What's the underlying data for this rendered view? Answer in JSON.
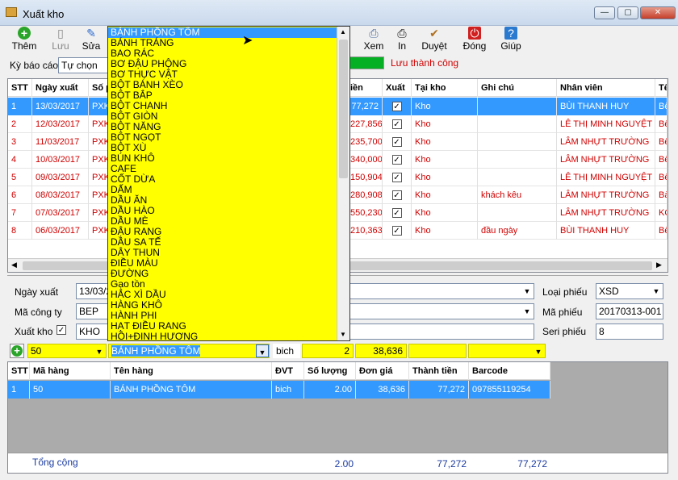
{
  "window": {
    "title": "Xuất kho",
    "min": "—",
    "max": "▢",
    "close": "✕"
  },
  "toolbar": [
    {
      "label": "Thêm",
      "icon": "add-icon",
      "glyph": "+"
    },
    {
      "label": "Lưu",
      "icon": "save-icon",
      "glyph": "▯"
    },
    {
      "label": "Sửa",
      "icon": "edit-icon",
      "glyph": "✎"
    },
    {
      "label": "Xem",
      "icon": "preview-icon",
      "glyph": "⎙"
    },
    {
      "label": "In",
      "icon": "print-icon",
      "glyph": "⎙"
    },
    {
      "label": "Duyệt",
      "icon": "approve-icon",
      "glyph": "✔"
    },
    {
      "label": "Đóng",
      "icon": "power-icon",
      "glyph": "⏻"
    },
    {
      "label": "Giúp",
      "icon": "help-book-icon",
      "glyph": "?"
    }
  ],
  "filter": {
    "label": "Kỳ báo cáo",
    "value": "Tự chọn"
  },
  "status": {
    "text": "Lưu thành công",
    "color": "#d00000",
    "bar_color": "#06b025",
    "progress": 1.0
  },
  "main_grid": {
    "headers": [
      "STT",
      "Ngày xuất",
      "Số p",
      "iền",
      "Xuất",
      "Tại kho",
      "Ghi chú",
      "Nhân viên",
      "Tê"
    ],
    "rows": [
      {
        "stt": "1",
        "date": "13/03/2017",
        "so": "PXK",
        "tien": "77,272",
        "kho": "Kho",
        "note": "",
        "nv": "BÙI THANH HUY",
        "te": "Bế"
      },
      {
        "stt": "2",
        "date": "12/03/2017",
        "so": "PXK",
        "tien": "227,856",
        "kho": "Kho",
        "note": "",
        "nv": "LÊ THỊ MINH NGUYỆT",
        "te": "Bế"
      },
      {
        "stt": "3",
        "date": "11/03/2017",
        "so": "PXK",
        "tien": "235,700",
        "kho": "Kho",
        "note": "",
        "nv": "LÂM NHỰT TRƯỜNG",
        "te": "Bế"
      },
      {
        "stt": "4",
        "date": "10/03/2017",
        "so": "PXK",
        "tien": "340,000",
        "kho": "Kho",
        "note": "",
        "nv": "LÂM NHỰT TRƯỜNG",
        "te": "Bế"
      },
      {
        "stt": "5",
        "date": "09/03/2017",
        "so": "PXK",
        "tien": "150,904",
        "kho": "Kho",
        "note": "",
        "nv": "LÊ THỊ MINH NGUYỆT",
        "te": "Bế"
      },
      {
        "stt": "6",
        "date": "08/03/2017",
        "so": "PXK",
        "tien": "280,908",
        "kho": "Kho",
        "note": "khách kêu",
        "nv": "LÂM NHỰT TRƯỜNG",
        "te": "Bà"
      },
      {
        "stt": "7",
        "date": "07/03/2017",
        "so": "PXK",
        "tien": "550,230",
        "kho": "Kho",
        "note": "",
        "nv": "LÂM NHỰT TRƯỜNG",
        "te": "KQ"
      },
      {
        "stt": "8",
        "date": "06/03/2017",
        "so": "PXK",
        "tien": "210,363",
        "kho": "Kho",
        "note": "đầu ngày",
        "nv": "BÙI THANH HUY",
        "te": "Bế"
      }
    ]
  },
  "form": {
    "ngay_xuat_label": "Ngày xuất",
    "ngay_xuat": "13/03/2",
    "ma_cty_label": "Mã công ty",
    "ma_cty": "BEP",
    "xuat_kho_label": "Xuất kho",
    "xuat_kho": "KHO",
    "loai_phieu_label": "Loại phiếu",
    "loai_phieu": "XSD",
    "ma_phieu_label": "Mã phiếu",
    "ma_phieu": "20170313-001",
    "seri_label": "Seri phiếu",
    "seri": "8"
  },
  "entry": {
    "ma": "50",
    "ten": "BÁNH PHỒNG TÔM",
    "dvt": "bich",
    "sl": "2",
    "gia": "38,636"
  },
  "detail_grid": {
    "headers": [
      "STT",
      "Mã hàng",
      "Tên hàng",
      "ĐVT",
      "Số lượng",
      "Đơn giá",
      "Thành tiền",
      "Barcode"
    ],
    "rows": [
      {
        "stt": "1",
        "ma": "50",
        "ten": "BÁNH PHỒNG TÔM",
        "dvt": "bich",
        "sl": "2.00",
        "gia": "38,636",
        "tt": "77,272",
        "bc": "097855119254"
      }
    ]
  },
  "totals": {
    "label": "Tổng cộng",
    "sl": "2.00",
    "tt": "77,272",
    "tt2": "77,272"
  },
  "dropdown_items": [
    "BÁNH PHỒNG TÔM",
    "BÁNH TRÁNG",
    "BAO RÁC",
    "BƠ ĐẬU PHỘNG",
    "BƠ THỰC VẬT",
    "BỘT BÁNH XÈO",
    "BỘT BẮP",
    "BỘT CHANH",
    "BỘT GIÒN",
    "BỘT NĂNG",
    "BỘT NGỌT",
    "BỘT XÙ",
    "BÚN KHÔ",
    "CAFE",
    "CỐT DỪA",
    "DẤM",
    "DẦU ĂN",
    "DẦU HÀO",
    "DẦU MÈ",
    "ĐẬU RANG",
    "DẦU SA TẾ",
    "DÂY THUN",
    "ĐIỀU MÀU",
    "ĐƯỜNG",
    "Gạo tồn",
    "HẮC XÌ DẦU",
    "HÀNG KHÔ",
    "HÀNH PHI",
    "HẠT ĐIỀU RANG",
    "HỒI+ĐINH HƯƠNG"
  ]
}
